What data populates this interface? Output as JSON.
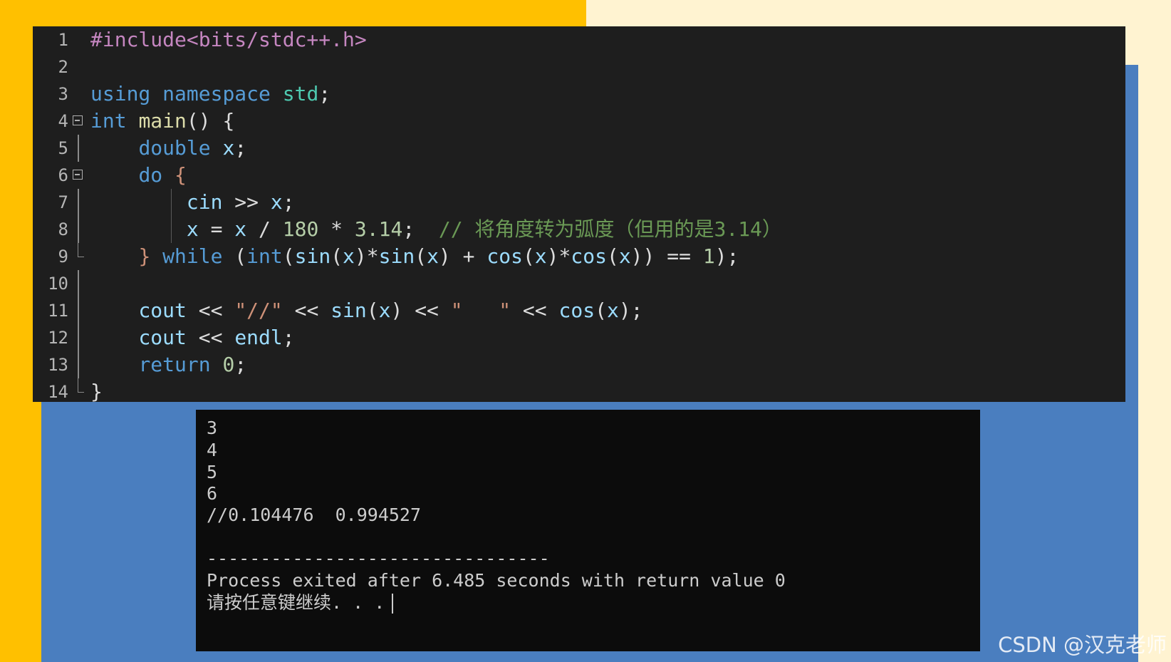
{
  "editor": {
    "lines": [
      {
        "num": "1",
        "segments": [
          {
            "cls": "pp",
            "text": "#include<bits/stdc++.h>"
          }
        ]
      },
      {
        "num": "2",
        "segments": []
      },
      {
        "num": "3",
        "segments": [
          {
            "cls": "kw",
            "text": "using"
          },
          {
            "cls": "pn",
            "text": " "
          },
          {
            "cls": "kw",
            "text": "namespace"
          },
          {
            "cls": "pn",
            "text": " "
          },
          {
            "cls": "ty",
            "text": "std"
          },
          {
            "cls": "pn",
            "text": ";"
          }
        ]
      },
      {
        "num": "4",
        "segments": [
          {
            "cls": "kw",
            "text": "int"
          },
          {
            "cls": "pn",
            "text": " "
          },
          {
            "cls": "fn",
            "text": "main"
          },
          {
            "cls": "pn",
            "text": "() {"
          }
        ]
      },
      {
        "num": "5",
        "segments": [
          {
            "cls": "pn",
            "text": "    "
          },
          {
            "cls": "kw",
            "text": "double"
          },
          {
            "cls": "pn",
            "text": " "
          },
          {
            "cls": "id",
            "text": "x"
          },
          {
            "cls": "pn",
            "text": ";"
          }
        ]
      },
      {
        "num": "6",
        "segments": [
          {
            "cls": "pn",
            "text": "    "
          },
          {
            "cls": "kw",
            "text": "do"
          },
          {
            "cls": "pn",
            "text": " "
          },
          {
            "cls": "str",
            "text": "{"
          }
        ]
      },
      {
        "num": "7",
        "segments": [
          {
            "cls": "pn",
            "text": "        "
          },
          {
            "cls": "id",
            "text": "cin"
          },
          {
            "cls": "pn",
            "text": " >> "
          },
          {
            "cls": "id",
            "text": "x"
          },
          {
            "cls": "pn",
            "text": ";"
          }
        ]
      },
      {
        "num": "8",
        "segments": [
          {
            "cls": "pn",
            "text": "        "
          },
          {
            "cls": "id",
            "text": "x"
          },
          {
            "cls": "pn",
            "text": " = "
          },
          {
            "cls": "id",
            "text": "x"
          },
          {
            "cls": "pn",
            "text": " / "
          },
          {
            "cls": "num",
            "text": "180"
          },
          {
            "cls": "pn",
            "text": " * "
          },
          {
            "cls": "num",
            "text": "3.14"
          },
          {
            "cls": "pn",
            "text": ";  "
          },
          {
            "cls": "cm",
            "text": "// 将角度转为弧度（但用的是3.14）"
          }
        ]
      },
      {
        "num": "9",
        "segments": [
          {
            "cls": "pn",
            "text": "    "
          },
          {
            "cls": "str",
            "text": "}"
          },
          {
            "cls": "pn",
            "text": " "
          },
          {
            "cls": "kw",
            "text": "while"
          },
          {
            "cls": "pn",
            "text": " ("
          },
          {
            "cls": "kw",
            "text": "int"
          },
          {
            "cls": "pn",
            "text": "("
          },
          {
            "cls": "fnc",
            "text": "sin"
          },
          {
            "cls": "pn",
            "text": "("
          },
          {
            "cls": "id",
            "text": "x"
          },
          {
            "cls": "pn",
            "text": ")*"
          },
          {
            "cls": "fnc",
            "text": "sin"
          },
          {
            "cls": "pn",
            "text": "("
          },
          {
            "cls": "id",
            "text": "x"
          },
          {
            "cls": "pn",
            "text": ") + "
          },
          {
            "cls": "fnc",
            "text": "cos"
          },
          {
            "cls": "pn",
            "text": "("
          },
          {
            "cls": "id",
            "text": "x"
          },
          {
            "cls": "pn",
            "text": ")*"
          },
          {
            "cls": "fnc",
            "text": "cos"
          },
          {
            "cls": "pn",
            "text": "("
          },
          {
            "cls": "id",
            "text": "x"
          },
          {
            "cls": "pn",
            "text": ")) == "
          },
          {
            "cls": "num",
            "text": "1"
          },
          {
            "cls": "pn",
            "text": ");"
          }
        ]
      },
      {
        "num": "10",
        "segments": []
      },
      {
        "num": "11",
        "segments": [
          {
            "cls": "pn",
            "text": "    "
          },
          {
            "cls": "id",
            "text": "cout"
          },
          {
            "cls": "pn",
            "text": " << "
          },
          {
            "cls": "str",
            "text": "\"//\""
          },
          {
            "cls": "pn",
            "text": " << "
          },
          {
            "cls": "fnc",
            "text": "sin"
          },
          {
            "cls": "pn",
            "text": "("
          },
          {
            "cls": "id",
            "text": "x"
          },
          {
            "cls": "pn",
            "text": ") << "
          },
          {
            "cls": "str",
            "text": "\"   \""
          },
          {
            "cls": "pn",
            "text": " << "
          },
          {
            "cls": "fnc",
            "text": "cos"
          },
          {
            "cls": "pn",
            "text": "("
          },
          {
            "cls": "id",
            "text": "x"
          },
          {
            "cls": "pn",
            "text": ");"
          }
        ]
      },
      {
        "num": "12",
        "segments": [
          {
            "cls": "pn",
            "text": "    "
          },
          {
            "cls": "id",
            "text": "cout"
          },
          {
            "cls": "pn",
            "text": " << "
          },
          {
            "cls": "id",
            "text": "endl"
          },
          {
            "cls": "pn",
            "text": ";"
          }
        ]
      },
      {
        "num": "13",
        "segments": [
          {
            "cls": "pn",
            "text": "    "
          },
          {
            "cls": "kw",
            "text": "return"
          },
          {
            "cls": "pn",
            "text": " "
          },
          {
            "cls": "num",
            "text": "0"
          },
          {
            "cls": "pn",
            "text": ";"
          }
        ]
      },
      {
        "num": "14",
        "segments": [
          {
            "cls": "pn",
            "text": "}"
          }
        ]
      }
    ]
  },
  "console": {
    "lines": [
      "3",
      "4",
      "5",
      "6",
      "//0.104476  0.994527",
      "",
      "--------------------------------",
      "Process exited after 6.485 seconds with return value 0",
      "请按任意键继续. . ."
    ]
  },
  "watermark": "CSDN @汉克老师"
}
